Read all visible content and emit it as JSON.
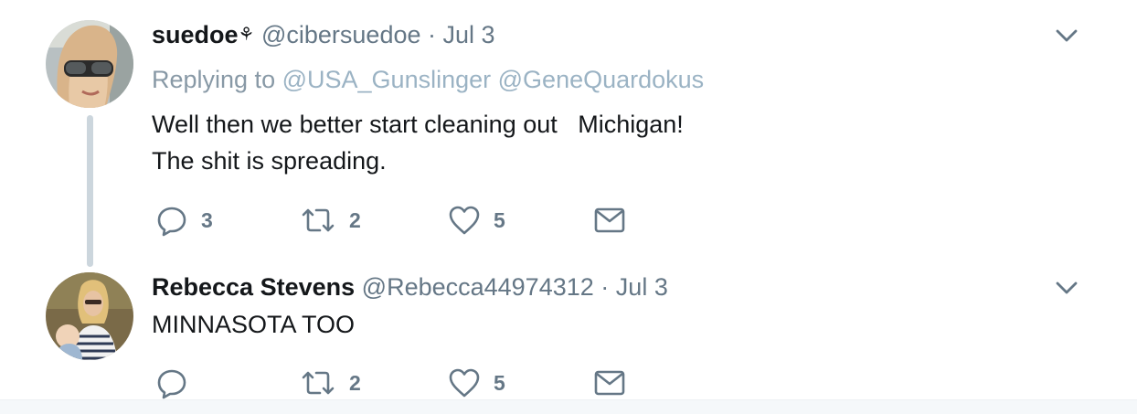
{
  "colors": {
    "text": "#14171a",
    "secondary": "#657786",
    "mention": "#9bb3c4",
    "thread_line": "#ccd6dd"
  },
  "tweets": [
    {
      "name": "suedoe",
      "name_emblem": "⚘",
      "handle": "@cibersuedoe",
      "separator": "·",
      "date": "Jul 3",
      "replying_prefix": "Replying to",
      "replying_mentions": [
        "@USA_Gunslinger",
        "@GeneQuardokus"
      ],
      "text": "Well then we better start cleaning out   Michigan!\nThe shit is spreading.",
      "actions": {
        "reply_count": "3",
        "retweet_count": "2",
        "like_count": "5"
      },
      "icons": [
        "chevron-down-icon",
        "reply-icon",
        "retweet-icon",
        "heart-icon",
        "envelope-icon"
      ]
    },
    {
      "name": "Rebecca Stevens",
      "handle": "@Rebecca44974312",
      "separator": "·",
      "date": "Jul 3",
      "text": "MINNASOTA TOO",
      "actions": {
        "reply_count": "",
        "retweet_count": "2",
        "like_count": "5"
      },
      "icons": [
        "chevron-down-icon",
        "reply-icon",
        "retweet-icon",
        "heart-icon",
        "envelope-icon"
      ]
    }
  ]
}
